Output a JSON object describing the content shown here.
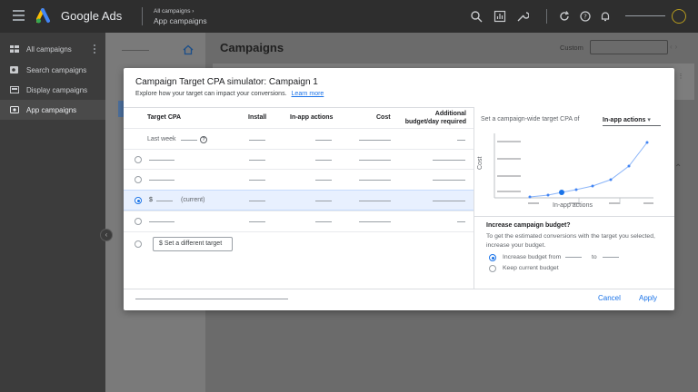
{
  "header": {
    "brand": "Google Ads",
    "breadcrumb_parent": "All campaigns",
    "breadcrumb_current": "App campaigns",
    "icons": [
      "search-icon",
      "reports-icon",
      "tools-icon",
      "refresh-icon",
      "help-icon",
      "notifications-icon"
    ]
  },
  "sidebar": {
    "items": [
      {
        "label": "All campaigns",
        "icon": "grid-icon"
      },
      {
        "label": "Search campaigns",
        "icon": "search-campaign-icon"
      },
      {
        "label": "Display campaigns",
        "icon": "display-icon"
      },
      {
        "label": "App campaigns",
        "icon": "app-icon"
      }
    ]
  },
  "page": {
    "title": "Campaigns",
    "date_range_label": "Custom"
  },
  "dialog": {
    "title": "Campaign Target CPA simulator: Campaign 1",
    "subtitle": "Explore how your target can impact your conversions.",
    "learn_more": "Learn more",
    "columns": [
      "Target CPA",
      "Install",
      "In-app actions",
      "Cost",
      "Additional budget/day required"
    ],
    "rows": {
      "last_week": "Last week",
      "current_prefix": "$",
      "current_suffix": "(current)",
      "selected_row": 3
    },
    "set_target_button": "$ Set a different target",
    "chart_header": "Set a campaign-wide target CPA of",
    "chart_metric": "In-app actions",
    "chart_ylabel": "Cost",
    "chart_xlabel": "In-app actions",
    "budget": {
      "title": "Increase campaign budget?",
      "description": "To get the estimated conversions with the target you selected, increase your budget.",
      "option_increase_prefix": "Increase budget from",
      "option_increase_mid": "to",
      "option_keep": "Keep current budget",
      "selected": "increase"
    },
    "cancel": "Cancel",
    "apply": "Apply"
  },
  "colors": {
    "accent": "#1a73e8",
    "topbar": "#2e2e2e",
    "sidebar": "#3c3c3c",
    "selected_row": "#e8f0fe",
    "chart_line": "#8ab4f8"
  }
}
